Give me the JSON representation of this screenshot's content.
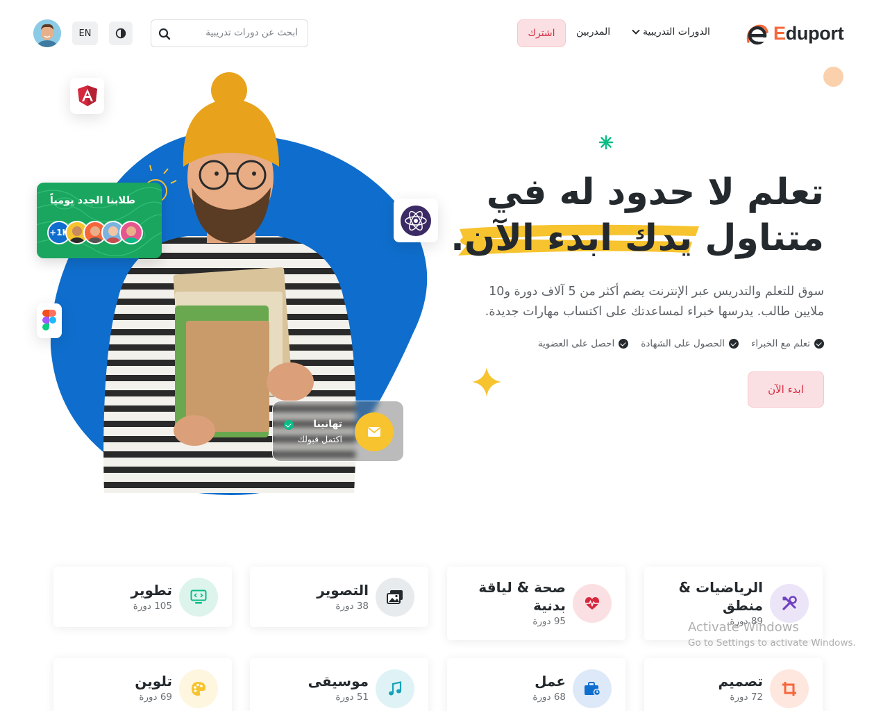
{
  "header": {
    "logo_text": "Eduport",
    "nav_courses": "الدورات التدريبية",
    "nav_trainers": "المدربين",
    "subscribe": "اشترك",
    "search_placeholder": "ابحث عن دورات تدريبية",
    "lang": "EN"
  },
  "hero": {
    "title_line1": "تعلم لا حدود له في",
    "title_line2_a": "متناول",
    "title_line2_b": "يدك ابدء الآن.",
    "description": "سوق للتعلم والتدريس عبر الإنترنت يضم أكثر من 5 آلاف دورة و10 ملايين طالب. يدرسها خبراء لمساعدتك على اكتساب مهارات جديدة.",
    "features": [
      "تعلم مع الخبراء",
      "الحصول على الشهادة",
      "احصل على العضوية"
    ],
    "cta": "ابدء الآن"
  },
  "students_card": {
    "title": "طلابنا الجدد يومياً",
    "count": "+1K"
  },
  "congrats_card": {
    "title": "تهانينا",
    "subtitle": "اكتمل قبولك"
  },
  "categories": [
    {
      "name": "تطوير",
      "count": "105 دورة",
      "icon": "monitor-code-icon",
      "color": "#0cbc87",
      "bg": "#ddf4ec"
    },
    {
      "name": "التصوير",
      "count": "38 دورة",
      "icon": "images-icon",
      "color": "#24292d",
      "bg": "#e8ebee"
    },
    {
      "name": "صحة & لياقة بدنية",
      "count": "95 دورة",
      "icon": "heart-pulse-icon",
      "color": "#d6293e",
      "bg": "#fbe0e3"
    },
    {
      "name": "الرياضيات & منطق",
      "count": "89 دورة",
      "icon": "tools-icon",
      "color": "#6f42c1",
      "bg": "#ece5f7"
    },
    {
      "name": "تلوين",
      "count": "69 دورة",
      "icon": "palette-icon",
      "color": "#f7c32e",
      "bg": "#fef6df"
    },
    {
      "name": "موسيقى",
      "count": "51 دورة",
      "icon": "music-note-icon",
      "color": "#17a2b8",
      "bg": "#dff3f6"
    },
    {
      "name": "عمل",
      "count": "68 دورة",
      "icon": "briefcase-icon",
      "color": "#0f6ecd",
      "bg": "#dde9f8"
    },
    {
      "name": "تصميم",
      "count": "72 دورة",
      "icon": "crop-icon",
      "color": "#f7663b",
      "bg": "#fde7df"
    }
  ],
  "watermark": {
    "line1": "Activate Windows",
    "line2": "Go to Settings to activate Windows."
  },
  "colors": {
    "brand_orange": "#f7663b",
    "primary_blue": "#0f6ecd",
    "danger": "#d6293e",
    "warning": "#f7c32e",
    "success": "#1aa65f"
  }
}
